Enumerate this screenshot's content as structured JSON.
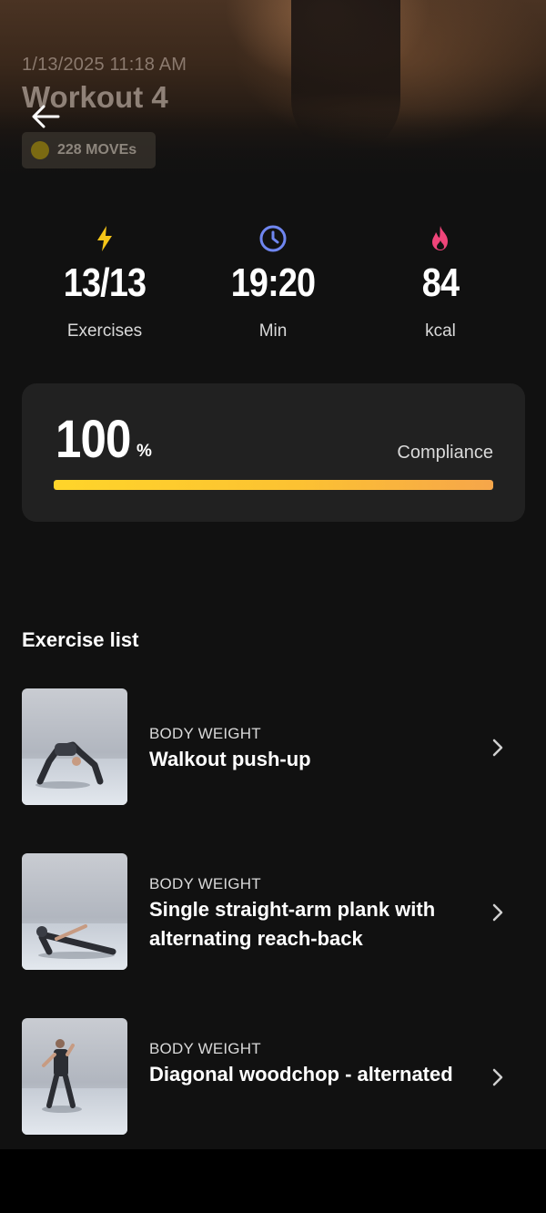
{
  "header": {
    "datetime": "1/13/2025 11:18 AM",
    "title": "Workout 4",
    "moves": "228 MOVEs"
  },
  "stats": {
    "exercises": {
      "value": "13/13",
      "label": "Exercises",
      "icon": "lightning-icon",
      "color": "#f5c518"
    },
    "time": {
      "value": "19:20",
      "label": "Min",
      "icon": "clock-icon",
      "color": "#6f86f0"
    },
    "calories": {
      "value": "84",
      "label": "kcal",
      "icon": "flame-icon",
      "color": "#f0457a"
    }
  },
  "compliance": {
    "value": "100",
    "unit": "%",
    "label": "Compliance",
    "progress": 1.0
  },
  "exercise_list": {
    "title": "Exercise list",
    "items": [
      {
        "category": "BODY WEIGHT",
        "name": "Walkout push-up"
      },
      {
        "category": "BODY WEIGHT",
        "name": "Single straight-arm plank with alternating reach-back"
      },
      {
        "category": "BODY WEIGHT",
        "name": "Diagonal woodchop - alternated"
      }
    ]
  },
  "colors": {
    "background": "#111111",
    "card": "#212121",
    "accent_start": "#ffd52a",
    "accent_end": "#f6a64a"
  }
}
